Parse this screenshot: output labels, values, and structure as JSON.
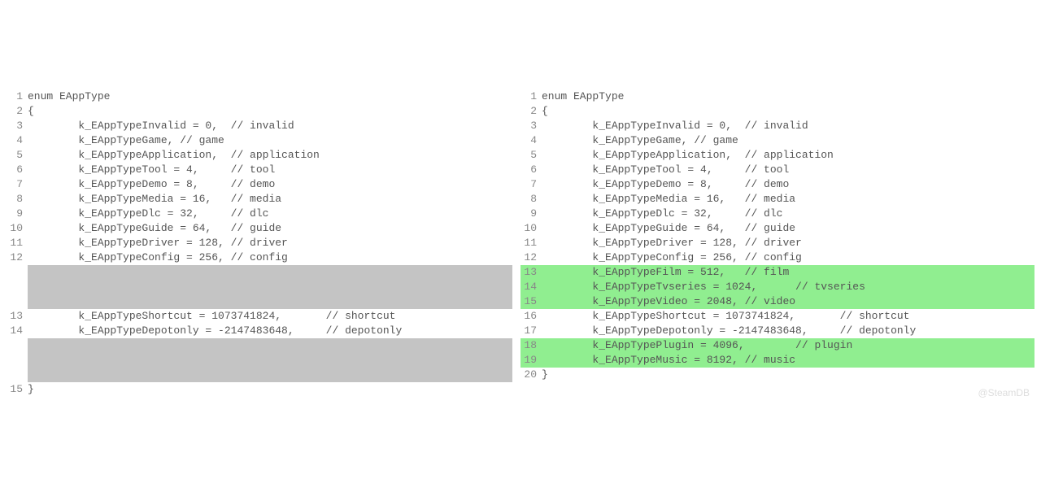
{
  "left": {
    "lines": [
      {
        "n": "1",
        "t": "enum EAppType",
        "hl": "none"
      },
      {
        "n": "2",
        "t": "{",
        "hl": "none"
      },
      {
        "n": "3",
        "t": "        k_EAppTypeInvalid = 0,  // invalid",
        "hl": "none"
      },
      {
        "n": "4",
        "t": "        k_EAppTypeGame, // game",
        "hl": "none"
      },
      {
        "n": "5",
        "t": "        k_EAppTypeApplication,  // application",
        "hl": "none"
      },
      {
        "n": "6",
        "t": "        k_EAppTypeTool = 4,     // tool",
        "hl": "none"
      },
      {
        "n": "7",
        "t": "        k_EAppTypeDemo = 8,     // demo",
        "hl": "none"
      },
      {
        "n": "8",
        "t": "        k_EAppTypeMedia = 16,   // media",
        "hl": "none"
      },
      {
        "n": "9",
        "t": "        k_EAppTypeDlc = 32,     // dlc",
        "hl": "none"
      },
      {
        "n": "10",
        "t": "        k_EAppTypeGuide = 64,   // guide",
        "hl": "none"
      },
      {
        "n": "11",
        "t": "        k_EAppTypeDriver = 128, // driver",
        "hl": "none"
      },
      {
        "n": "12",
        "t": "        k_EAppTypeConfig = 256, // config",
        "hl": "none"
      },
      {
        "n": "",
        "t": "",
        "hl": "gap"
      },
      {
        "n": "13",
        "t": "        k_EAppTypeShortcut = 1073741824,       // shortcut",
        "hl": "none"
      },
      {
        "n": "14",
        "t": "        k_EAppTypeDepotonly = -2147483648,     // depotonly",
        "hl": "none"
      },
      {
        "n": "",
        "t": "",
        "hl": "gap"
      },
      {
        "n": "15",
        "t": "}",
        "hl": "none"
      }
    ]
  },
  "right": {
    "lines": [
      {
        "n": "1",
        "t": "enum EAppType",
        "hl": "none"
      },
      {
        "n": "2",
        "t": "{",
        "hl": "none"
      },
      {
        "n": "3",
        "t": "        k_EAppTypeInvalid = 0,  // invalid",
        "hl": "none"
      },
      {
        "n": "4",
        "t": "        k_EAppTypeGame, // game",
        "hl": "none"
      },
      {
        "n": "5",
        "t": "        k_EAppTypeApplication,  // application",
        "hl": "none"
      },
      {
        "n": "6",
        "t": "        k_EAppTypeTool = 4,     // tool",
        "hl": "none"
      },
      {
        "n": "7",
        "t": "        k_EAppTypeDemo = 8,     // demo",
        "hl": "none"
      },
      {
        "n": "8",
        "t": "        k_EAppTypeMedia = 16,   // media",
        "hl": "none"
      },
      {
        "n": "9",
        "t": "        k_EAppTypeDlc = 32,     // dlc",
        "hl": "none"
      },
      {
        "n": "10",
        "t": "        k_EAppTypeGuide = 64,   // guide",
        "hl": "none"
      },
      {
        "n": "11",
        "t": "        k_EAppTypeDriver = 128, // driver",
        "hl": "none"
      },
      {
        "n": "12",
        "t": "        k_EAppTypeConfig = 256, // config",
        "hl": "none"
      },
      {
        "n": "13",
        "t": "        k_EAppTypeFilm = 512,   // film",
        "hl": "green"
      },
      {
        "n": "14",
        "t": "        k_EAppTypeTvseries = 1024,      // tvseries",
        "hl": "green"
      },
      {
        "n": "15",
        "t": "        k_EAppTypeVideo = 2048, // video",
        "hl": "green"
      },
      {
        "n": "16",
        "t": "        k_EAppTypeShortcut = 1073741824,       // shortcut",
        "hl": "none"
      },
      {
        "n": "17",
        "t": "        k_EAppTypeDepotonly = -2147483648,     // depotonly",
        "hl": "none"
      },
      {
        "n": "18",
        "t": "        k_EAppTypePlugin = 4096,        // plugin",
        "hl": "green"
      },
      {
        "n": "19",
        "t": "        k_EAppTypeMusic = 8192, // music",
        "hl": "green"
      },
      {
        "n": "20",
        "t": "}",
        "hl": "none"
      }
    ]
  },
  "watermark": "@SteamDB"
}
